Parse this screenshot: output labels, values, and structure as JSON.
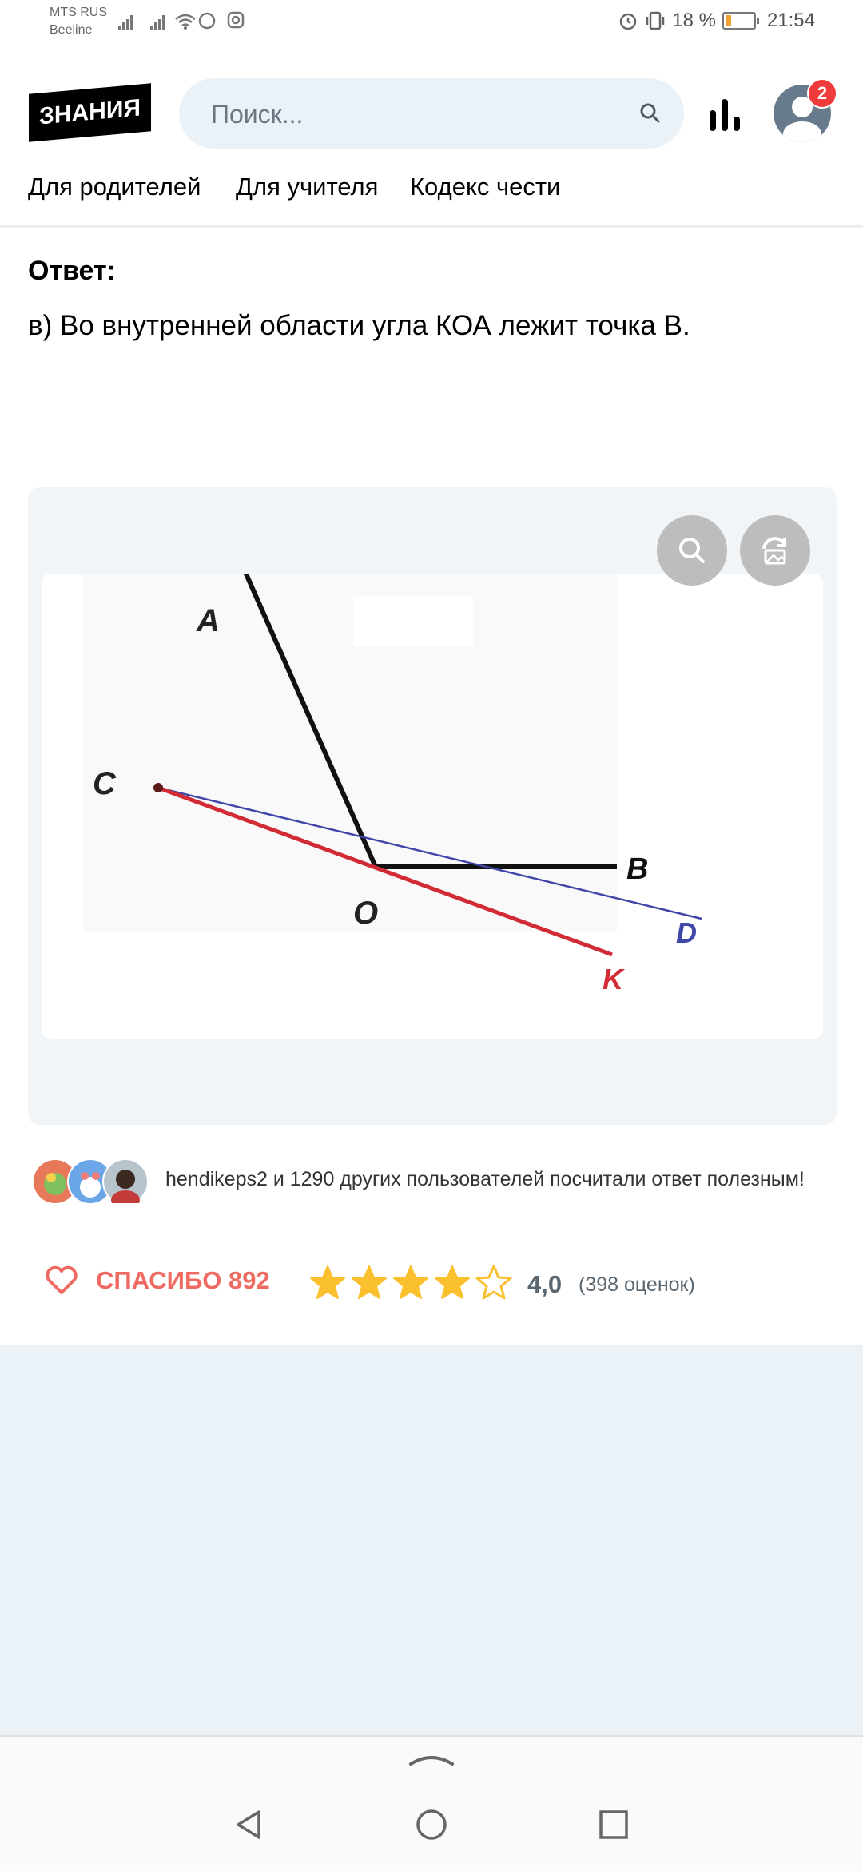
{
  "status_bar": {
    "carrier1": "MTS RUS",
    "carrier2": "Beeline",
    "battery": "18 %",
    "time": "21:54"
  },
  "header": {
    "logo": "ЗНАНИЯ",
    "search_placeholder": "Поиск...",
    "notification_count": "2",
    "nav": [
      "Для родителей",
      "Для учителя",
      "Кодекс чести"
    ]
  },
  "answer": {
    "label": "Ответ:",
    "text": "в) Во внутренней области угла КОА лежит точка В."
  },
  "figure": {
    "labels": {
      "A": "A",
      "C": "C",
      "O": "O",
      "B": "B",
      "D": "D",
      "K": "K"
    }
  },
  "helpful": {
    "text": "hendikeps2 и 1290 других пользователей посчитали ответ полезным!"
  },
  "actions": {
    "thanks": "СПАСИБО 892",
    "rating": "4,0",
    "votes": "(398 оценок)",
    "stars": 4,
    "stars_max": 5
  },
  "colors": {
    "accent": "#ef6b61",
    "star": "#fbc02d",
    "red_line": "#d12b36",
    "blue_line": "#3f47a8"
  }
}
